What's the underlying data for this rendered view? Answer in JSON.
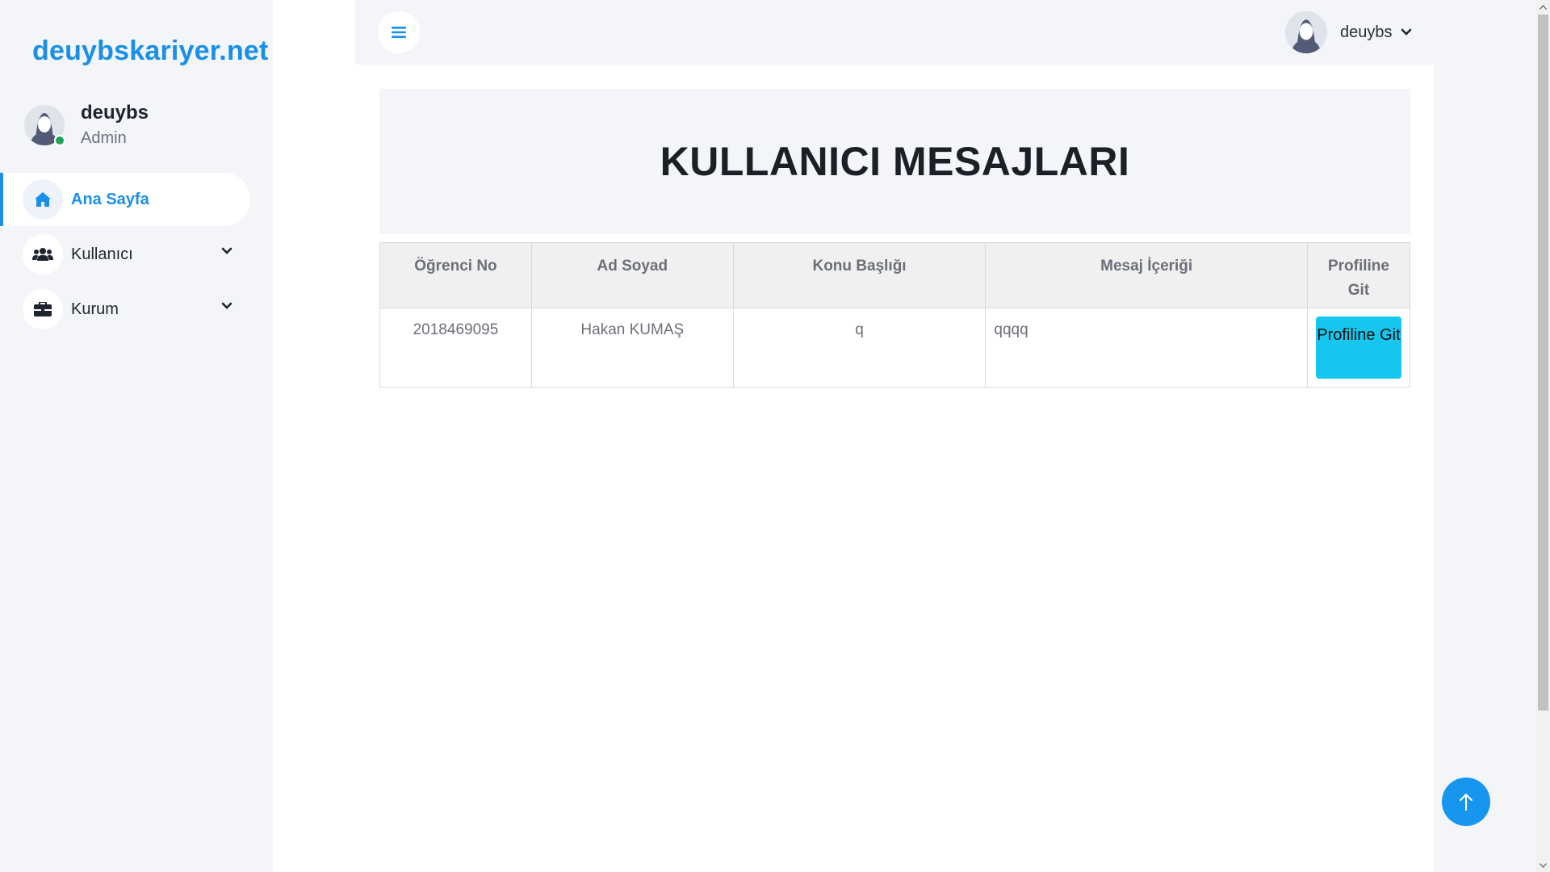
{
  "sidebar": {
    "brand": "deuybskariyer.net",
    "profile": {
      "name": "deuybs",
      "role": "Admin"
    },
    "items": [
      {
        "label": "Ana Sayfa",
        "icon": "home-icon",
        "active": true
      },
      {
        "label": "Kullanıcı",
        "icon": "users-icon",
        "expandable": true
      },
      {
        "label": "Kurum",
        "icon": "briefcase-icon",
        "expandable": true
      }
    ]
  },
  "topbar": {
    "menu_icon": "hamburger-icon",
    "user_name": "deuybs"
  },
  "page": {
    "title": "KULLANICI MESAJLARI"
  },
  "table": {
    "headers": [
      "Öğrenci No",
      "Ad Soyad",
      "Konu Başlığı",
      "Mesaj İçeriği",
      "Profiline Git"
    ],
    "rows": [
      {
        "student_no": "2018469095",
        "full_name": "Hakan KUMAŞ",
        "subject": "q",
        "message": "qqqq",
        "action_label": "Profiline Git"
      }
    ]
  },
  "colors": {
    "accent": "#1a8fe8",
    "button": "#17c6ef",
    "background": "#f3f5f8",
    "online": "#20a45a"
  }
}
